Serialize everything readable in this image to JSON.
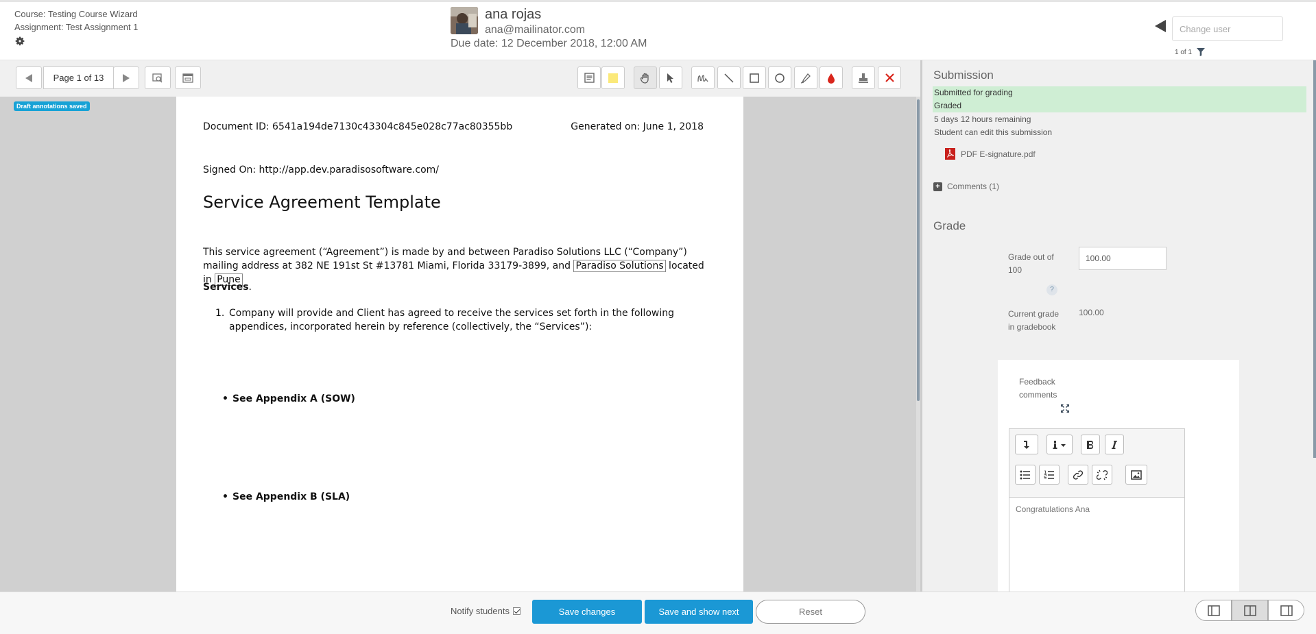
{
  "header": {
    "course": "Course: Testing Course Wizard",
    "assignment": "Assignment: Test Assignment 1",
    "user_name": "ana rojas",
    "user_email": "ana@mailinator.com",
    "due_date": "Due date: 12 December 2018, 12:00 AM",
    "change_user_placeholder": "Change user",
    "user_count": "1 of 1"
  },
  "pdf_toolbar": {
    "page_label": "Page 1 of 13",
    "icons": [
      "prev-page-icon",
      "next-page-icon",
      "search-comments-icon",
      "expand-comments-icon",
      "comment-icon",
      "highlight-icon",
      "pan-icon",
      "select-icon",
      "pen-icon",
      "line-icon",
      "rectangle-icon",
      "oval-icon",
      "highlighter-icon",
      "colour-icon",
      "stamp-icon",
      "delete-icon"
    ]
  },
  "draft_badge": "Draft annotations saved",
  "document": {
    "doc_id": "Document ID: 6541a194de7130c43304c845e028c77ac80355bb",
    "generated": "Generated on: June 1, 2018",
    "signed": "Signed On: http://app.dev.paradisosoftware.com/",
    "title": "Service Agreement Template",
    "para_part1": "This service agreement (“Agreement”) is made by  and between Paradiso Solutions LLC (“Company”) mailing address  at 382 NE 191st St #13781 Miami, Florida 33179-3899, and ",
    "para_field1": "Paradiso Solutions",
    "para_part2": " located in ",
    "para_field2": "Pune",
    "services_label": "Services",
    "services_dot": ".",
    "list_num": "1.",
    "list_text": "Company will provide and Client has agreed to receive the services set forth in the following appendices, incorporated herein by reference (collectively, the “Services”):",
    "bullet": "•",
    "appendix_a": "See Appendix A (SOW)",
    "appendix_b": "See Appendix B (SLA)"
  },
  "submission": {
    "title": "Submission",
    "status1": "Submitted for grading",
    "status2": "Graded",
    "time_remaining": "5 days 12 hours remaining",
    "edit_note": "Student can edit this submission",
    "file_name": "PDF E-signature.pdf",
    "comments": "Comments (1)"
  },
  "grade": {
    "title": "Grade",
    "grade_label": "Grade out of 100",
    "grade_value": "100.00",
    "help": "?",
    "current_label": "Current grade in gradebook",
    "current_value": "100.00",
    "feedback_label": "Feedback comments",
    "feedback_text": "Congratulations Ana"
  },
  "footer": {
    "notify_label": "Notify students",
    "save_label": "Save changes",
    "save_next_label": "Save and show next",
    "reset_label": "Reset"
  },
  "colors": {
    "primary_button": "#1b98d5",
    "status_green": "#cfeed4",
    "draft_badge": "#17a2d6",
    "delete_red": "#d9261c"
  }
}
